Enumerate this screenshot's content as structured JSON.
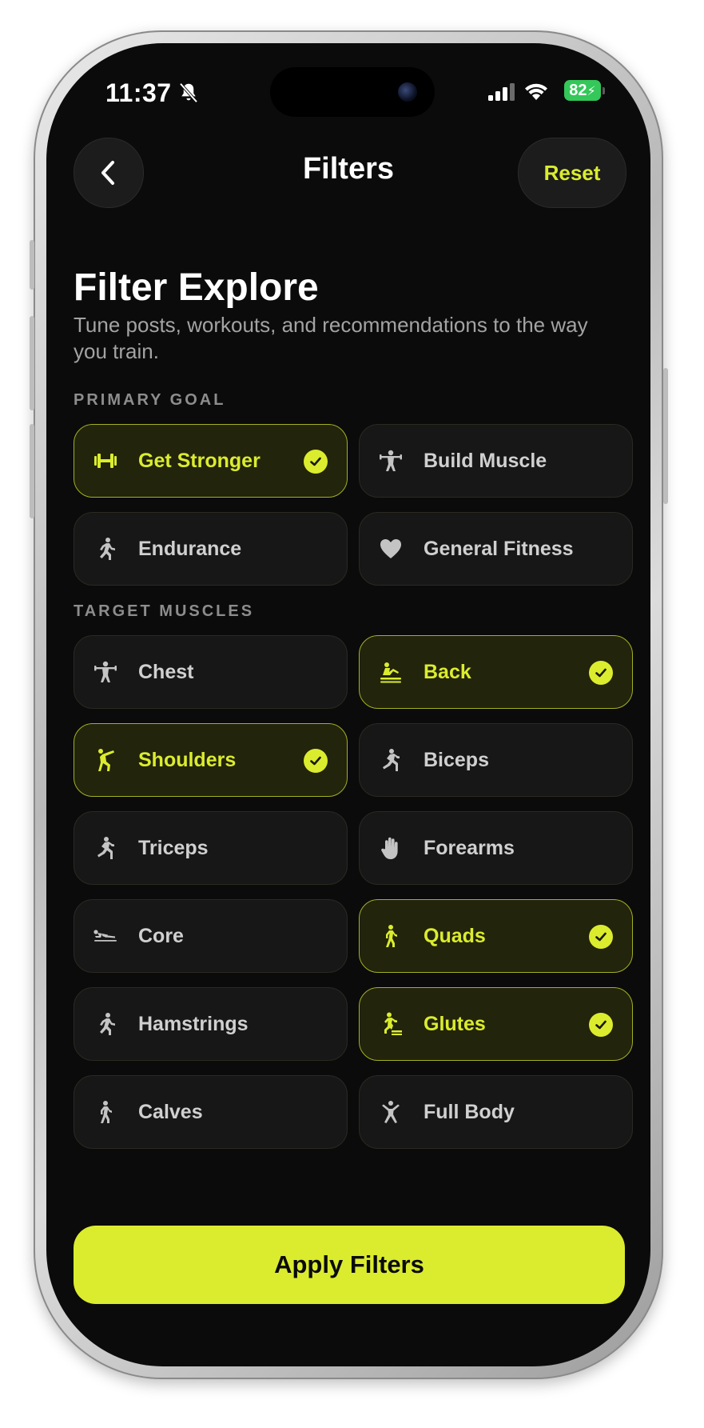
{
  "status_bar": {
    "time": "11:37",
    "battery": "82"
  },
  "nav": {
    "title": "Filters",
    "reset_label": "Reset"
  },
  "header": {
    "title": "Filter Explore",
    "subtitle": "Tune posts, workouts, and recommendations to the way you train."
  },
  "primary_goal": {
    "label": "PRIMARY GOAL",
    "options": [
      {
        "label": "Get Stronger",
        "icon": "dumbbell-icon",
        "selected": true
      },
      {
        "label": "Build Muscle",
        "icon": "weightlifter-icon",
        "selected": false
      },
      {
        "label": "Endurance",
        "icon": "runner-icon",
        "selected": false
      },
      {
        "label": "General Fitness",
        "icon": "heart-icon",
        "selected": false
      }
    ]
  },
  "target_muscles": {
    "label": "TARGET MUSCLES",
    "options": [
      {
        "label": "Chest",
        "icon": "weightlifter-icon",
        "selected": false
      },
      {
        "label": "Back",
        "icon": "rower-icon",
        "selected": true
      },
      {
        "label": "Shoulders",
        "icon": "arm-raise-icon",
        "selected": true
      },
      {
        "label": "Biceps",
        "icon": "lunge-icon",
        "selected": false
      },
      {
        "label": "Triceps",
        "icon": "lunge-icon",
        "selected": false
      },
      {
        "label": "Forearms",
        "icon": "hand-icon",
        "selected": false
      },
      {
        "label": "Core",
        "icon": "plank-icon",
        "selected": false
      },
      {
        "label": "Quads",
        "icon": "walker-icon",
        "selected": true
      },
      {
        "label": "Hamstrings",
        "icon": "runner-icon",
        "selected": false
      },
      {
        "label": "Glutes",
        "icon": "step-up-icon",
        "selected": true
      },
      {
        "label": "Calves",
        "icon": "walker-icon",
        "selected": false
      },
      {
        "label": "Full Body",
        "icon": "star-figure-icon",
        "selected": false
      }
    ]
  },
  "apply_label": "Apply Filters",
  "colors": {
    "accent": "#DBEC2E",
    "background": "#0B0B0B",
    "chip": "#171717",
    "chip_selected": "#22240C"
  }
}
